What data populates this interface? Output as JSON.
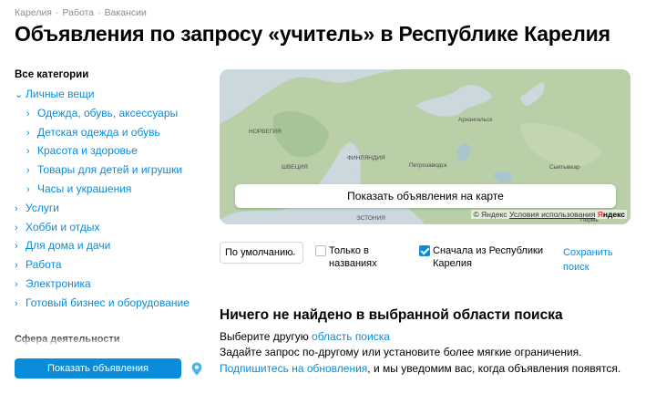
{
  "breadcrumb": [
    "Карелия",
    "Работа",
    "Вакансии"
  ],
  "title": "Объявления по запросу «учитель» в Республике Карелия",
  "sidebar": {
    "heading": "Все категории",
    "items": [
      {
        "label": "Личные вещи",
        "level": 0,
        "expanded": true
      },
      {
        "label": "Одежда, обувь, аксессуары",
        "level": 1
      },
      {
        "label": "Детская одежда и обувь",
        "level": 1
      },
      {
        "label": "Красота и здоровье",
        "level": 1
      },
      {
        "label": "Товары для детей и игрушки",
        "level": 1
      },
      {
        "label": "Часы и украшения",
        "level": 1
      },
      {
        "label": "Услуги",
        "level": 0
      },
      {
        "label": "Хобби и отдых",
        "level": 0
      },
      {
        "label": "Для дома и дачи",
        "level": 0
      },
      {
        "label": "Работа",
        "level": 0
      },
      {
        "label": "Электроника",
        "level": 0
      },
      {
        "label": "Готовый бизнес и оборудование",
        "level": 0
      }
    ],
    "sfera_heading": "Сфера деятельности",
    "show_button": "Показать объявления"
  },
  "map": {
    "labels": {
      "arkhangelsk": "Архангельск",
      "norway": "НОРВЕГИЯ",
      "finland": "ФИНЛЯНДИЯ",
      "sweden": "ШВЕЦИЯ",
      "petrozavodsk": "Петрозаводск",
      "syktyvkar": "Сыктывкар",
      "estonia": "ЭСТОНИЯ",
      "perm": "Пермь"
    },
    "button": "Показать объявления на карте",
    "copyright": "© Яндекс",
    "terms": "Условия использования",
    "logo_y": "Я",
    "logo_rest": "ндекс"
  },
  "filters": {
    "sort": "По умолчанию",
    "titles_only_line1": "Только в",
    "titles_only_line2": "названиях",
    "region_first_line1": "Сначала из Республики",
    "region_first_line2": "Карелия",
    "save_line1": "Сохранить",
    "save_line2": "поиск"
  },
  "empty": {
    "title": "Ничего не найдено в выбранной области поиска",
    "line1_prefix": "Выберите другую ",
    "line1_link": "область поиска",
    "line2": "Задайте запрос по-другому или установите более мягкие ограничения.",
    "line3_link": "Подпишитесь на обновления",
    "line3_suffix": ", и мы уведомим вас, когда объявления появятся."
  },
  "colors": {
    "accent": "#0a8cdb",
    "map_water": "#cbd9de",
    "map_land": "#b9cfa8"
  }
}
